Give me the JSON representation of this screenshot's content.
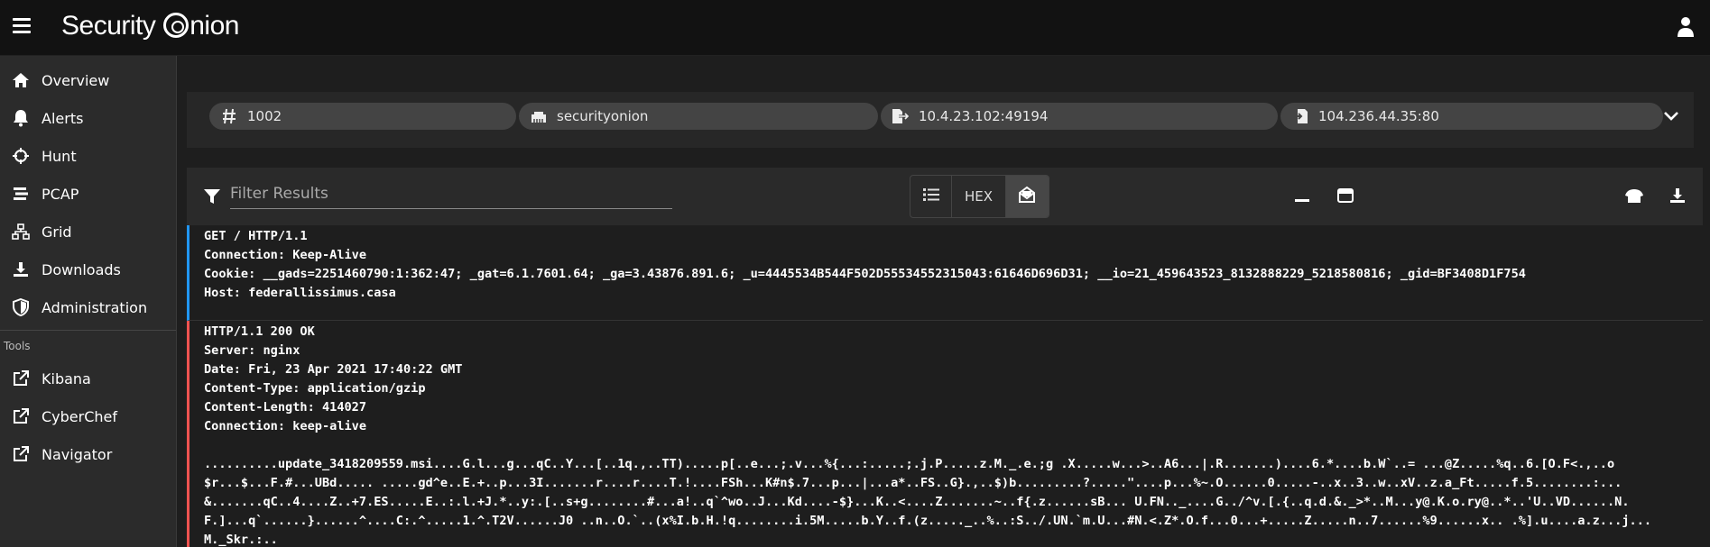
{
  "app": {
    "name": "Security Onion"
  },
  "nav": [
    {
      "label": "Overview",
      "icon": "home-icon"
    },
    {
      "label": "Alerts",
      "icon": "bell-icon"
    },
    {
      "label": "Hunt",
      "icon": "crosshairs-icon"
    },
    {
      "label": "PCAP",
      "icon": "stream-icon"
    },
    {
      "label": "Grid",
      "icon": "network-icon"
    },
    {
      "label": "Downloads",
      "icon": "download-icon"
    },
    {
      "label": "Administration",
      "icon": "shield-icon"
    }
  ],
  "tools_header": "Tools",
  "tools": [
    {
      "label": "Kibana",
      "icon": "external-link-icon"
    },
    {
      "label": "CyberChef",
      "icon": "external-link-icon"
    },
    {
      "label": "Navigator",
      "icon": "external-link-icon"
    }
  ],
  "chips": {
    "id": "1002",
    "sensor": "securityonion",
    "source": "10.4.23.102:49194",
    "destination": "104.236.44.35:80"
  },
  "toolbar": {
    "filter_placeholder": "Filter Results",
    "hex_label": "HEX"
  },
  "request_lines": [
    "GET / HTTP/1.1",
    "Connection: Keep-Alive",
    "Cookie: __gads=2251460790:1:362:47; _gat=6.1.7601.64; _ga=3.43876.891.6; _u=4445534B544F502D55534552315043:61646D696D31; __io=21_459643523_8132888229_5218580816; _gid=BF3408D1F754",
    "Host: federallissimus.casa"
  ],
  "response_lines": [
    "HTTP/1.1 200 OK",
    "Server: nginx",
    "Date: Fri, 23 Apr 2021 17:40:22 GMT",
    "Content-Type: application/gzip",
    "Content-Length: 414027",
    "Connection: keep-alive"
  ],
  "payload_lines": [
    "..........update_3418209559.msi....G.l...g...qC..Y...[..1q.,..TT).....p[..e...;.v...%{...:.....;.j.P.....z.M._.e.;g .X.....w...>..A6...|.R.......)....6.*....b.W`..= ...@Z.....%q..6.[O.F<.,..o",
    "$r...$...F.#...UBd..... .....gd^e..E.+..p...3I.......r....r....T.!....FSh...K#n$.7...p...|...a*..FS..G}.,..$)b.........?.....\"....p...%~.O......0.....-..x..3..w..xV..z.a_Ft.....f.5........:...",
    "&.......qC..4....Z..+7.ES.....E..:.l.+J.*..y:.[..s+g........#...a!..q`^wo..J...Kd....-$}...K..<....Z.......~..f{.z......sB... U.FN.._....G../^v.[.{..q.d.&._>*..M...y@.K.o.ry@..*..'U..VD......N.",
    "F.]...q`......}......^....C:.^.....1.^.T2V......J0 ..n..O.`..(x%I.b.H.!q........i.5M.....b.Y..f.(z....._..%..:S../.UN.`m.U...#N.<.Z*.O.f...0...+.....Z.....n..7......%9......x.. .%].u....a.z...j...",
    "M._Skr.:.."
  ]
}
